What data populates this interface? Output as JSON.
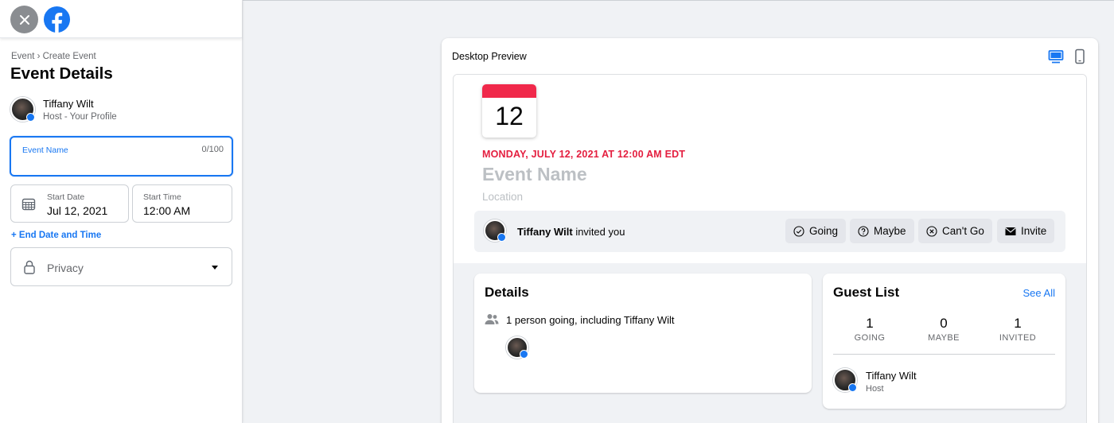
{
  "sidebar": {
    "breadcrumb": "Event › Create Event",
    "title": "Event Details",
    "host": {
      "name": "Tiffany Wilt",
      "role": "Host - Your Profile"
    },
    "event_name": {
      "label": "Event Name",
      "value": "",
      "counter": "0/100"
    },
    "start_date": {
      "label": "Start Date",
      "value": "Jul 12, 2021"
    },
    "start_time": {
      "label": "Start Time",
      "value": "12:00 AM"
    },
    "end_date_link": "+ End Date and Time",
    "privacy": {
      "value": "Privacy"
    }
  },
  "preview": {
    "title": "Desktop Preview",
    "views": [
      "desktop-icon",
      "mobile-icon"
    ],
    "calendar_day": "12",
    "event_date": "MONDAY, JULY 12, 2021 AT 12:00 AM EDT",
    "event_name": "Event Name",
    "location": "Location",
    "invite": {
      "name": "Tiffany Wilt",
      "suffix": " invited you"
    },
    "rsvp": {
      "going": "Going",
      "maybe": "Maybe",
      "cant_go": "Can't Go",
      "invite": "Invite"
    },
    "details": {
      "title": "Details",
      "going_text": "1 person going, including Tiffany Wilt"
    },
    "guest_list": {
      "title": "Guest List",
      "see_all": "See All",
      "stats": [
        {
          "num": "1",
          "label": "GOING"
        },
        {
          "num": "0",
          "label": "MAYBE"
        },
        {
          "num": "1",
          "label": "INVITED"
        }
      ],
      "guest": {
        "name": "Tiffany Wilt",
        "role": "Host"
      }
    }
  },
  "colors": {
    "accent": "#1877f2",
    "date_red": "#e41e3f",
    "calendar_red": "#f0284a"
  }
}
